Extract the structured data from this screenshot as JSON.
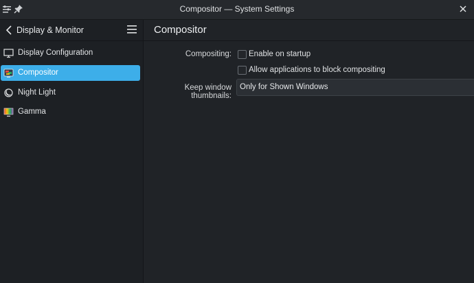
{
  "window": {
    "title": "Compositor — System Settings"
  },
  "sidebar": {
    "header": "Display & Monitor",
    "items": [
      {
        "label": "Display Configuration",
        "icon": "monitor-icon",
        "active": false
      },
      {
        "label": "Compositor",
        "icon": "compositor-icon",
        "active": true
      },
      {
        "label": "Night Light",
        "icon": "night-light-icon",
        "active": false
      },
      {
        "label": "Gamma",
        "icon": "gamma-icon",
        "active": false
      }
    ]
  },
  "page": {
    "title": "Compositor",
    "compositing_label": "Compositing:",
    "enable_on_startup": {
      "label": "Enable on startup",
      "checked": false
    },
    "allow_block": {
      "label": "Allow applications to block compositing",
      "checked": false
    },
    "thumbnails_label": "Keep window thumbnails:",
    "thumbnails_value": "Only for Shown Windows"
  },
  "colors": {
    "accent": "#3daee9",
    "background": "#202327",
    "sidebar": "#1d2024"
  }
}
